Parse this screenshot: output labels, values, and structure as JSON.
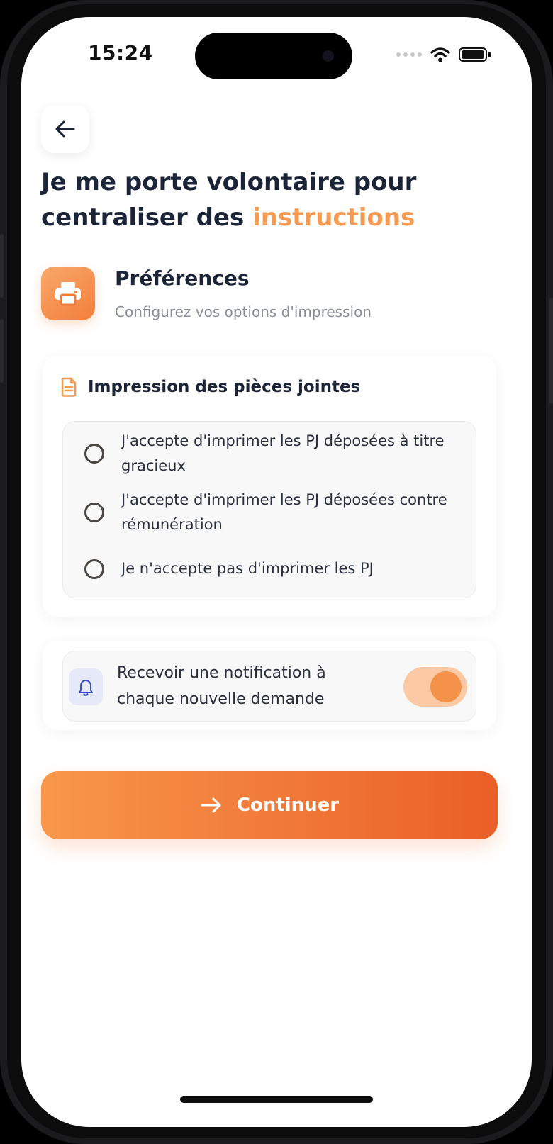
{
  "status_bar": {
    "time": "15:24"
  },
  "header": {
    "title_main": "Je me porte volontaire pour centraliser des",
    "title_accent": "instructions"
  },
  "preferences": {
    "title": "Préférences",
    "subtitle": "Configurez vos options d'impression"
  },
  "print_card": {
    "title": "Impression des pièces jointes",
    "options": [
      {
        "label": "J'accepte d'imprimer les PJ déposées à titre gracieux",
        "selected": false
      },
      {
        "label": "J'accepte d'imprimer les PJ déposées contre rémunération",
        "selected": false
      },
      {
        "label": "Je n'accepte pas d'imprimer les PJ",
        "selected": false
      }
    ]
  },
  "notification": {
    "label": "Recevoir une notification à chaque nouvelle demande",
    "enabled": true
  },
  "continue_button": {
    "label": "Continuer"
  },
  "colors": {
    "accent": "#f59a52",
    "button_start": "#f8974b",
    "button_end": "#ea5f27",
    "title_text": "#1c2438"
  },
  "icons": [
    "back-arrow-icon",
    "printer-icon",
    "document-icon",
    "bell-icon",
    "arrow-right-icon",
    "wifi-icon",
    "battery-icon",
    "signal-icon"
  ]
}
